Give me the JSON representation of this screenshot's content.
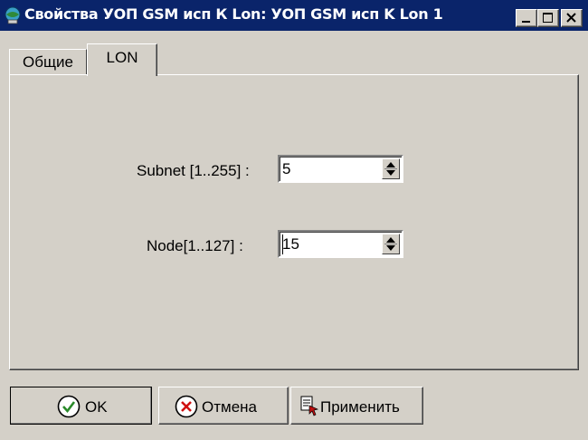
{
  "window": {
    "title": "Свойства УОП GSM исп К Lon: УОП GSM исп K Lon 1",
    "icon": "app-network-icon"
  },
  "tabs": [
    {
      "label": "Общие",
      "active": false
    },
    {
      "label": "LON",
      "active": true
    }
  ],
  "fields": {
    "subnet": {
      "label": "Subnet [1..255] :",
      "value": "5"
    },
    "node": {
      "label": "Node[1..127] :",
      "value": "15"
    }
  },
  "buttons": {
    "ok": {
      "label": "OK",
      "icon": "check-circle-icon"
    },
    "cancel": {
      "label": "Отмена",
      "icon": "cross-circle-icon"
    },
    "apply": {
      "label": "Применить",
      "icon": "apply-document-icon"
    }
  },
  "colors": {
    "title_bar": "#0a246a",
    "face": "#d4d0c8"
  }
}
